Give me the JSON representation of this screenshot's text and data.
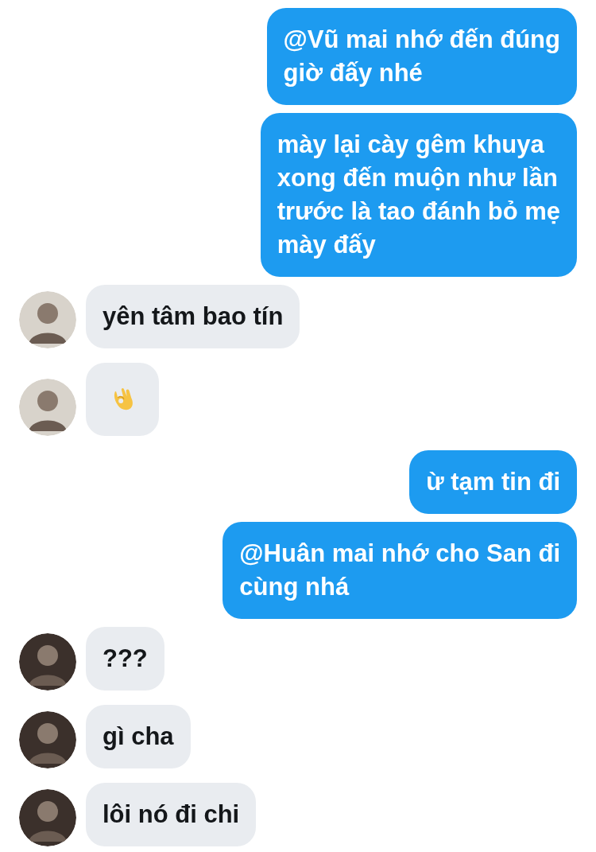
{
  "messages": [
    {
      "outgoing": true,
      "kind": "text",
      "text": "@Vũ mai nhớ đến đúng\ngiờ đấy nhé"
    },
    {
      "outgoing": true,
      "kind": "text",
      "text": "mày lại cày gêm khuya\nxong đến muộn như lần\ntrước là tao đánh bỏ mẹ\nmày đấy"
    },
    {
      "outgoing": false,
      "kind": "text",
      "text": "yên tâm bao tín",
      "color": "#d8d3cb"
    },
    {
      "outgoing": false,
      "kind": "icon",
      "color": "#d8d3cb"
    },
    {
      "outgoing": true,
      "kind": "text",
      "text": "ừ tạm tin đi"
    },
    {
      "outgoing": true,
      "kind": "text",
      "text": "@Huân mai nhớ cho San đi\ncùng nhá"
    },
    {
      "outgoing": false,
      "kind": "text",
      "text": "???",
      "color": "#3b302b"
    },
    {
      "outgoing": false,
      "kind": "text",
      "text": "gì cha",
      "color": "#3b302b"
    },
    {
      "outgoing": false,
      "kind": "text",
      "text": "lôi nó đi chi",
      "color": "#3b302b"
    }
  ]
}
